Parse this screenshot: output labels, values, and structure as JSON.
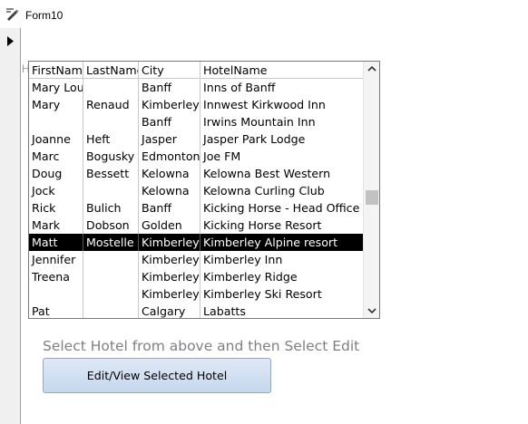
{
  "window": {
    "title": "Form10"
  },
  "listbox": {
    "label_stub": "H",
    "columns": [
      "FirstNam",
      "LastName",
      "City",
      "HotelName"
    ],
    "rows": [
      [
        "Mary Lou",
        "",
        "Banff",
        "Inns of Banff"
      ],
      [
        "Mary",
        "Renaud",
        "Kimberley",
        "Innwest Kirkwood Inn"
      ],
      [
        "",
        "",
        "Banff",
        "Irwins Mountain Inn"
      ],
      [
        "Joanne",
        "Heft",
        "Jasper",
        "Jasper Park Lodge"
      ],
      [
        "Marc",
        "Bogusky",
        "Edmonton",
        "Joe FM"
      ],
      [
        "Doug",
        "Bessett",
        "Kelowna",
        "Kelowna Best Western"
      ],
      [
        "Jock",
        "",
        "Kelowna",
        "Kelowna Curling Club"
      ],
      [
        "Rick",
        "Bulich",
        "Banff",
        "Kicking Horse - Head Office"
      ],
      [
        "Mark",
        "Dobson",
        "Golden",
        "Kicking Horse Resort"
      ],
      [
        "Matt",
        "Mostelle",
        "Kimberley",
        "Kimberley Alpine resort"
      ],
      [
        "Jennifer",
        "",
        "Kimberley",
        "Kimberley Inn"
      ],
      [
        "Treena",
        "",
        "Kimberley",
        "Kimberley Ridge"
      ],
      [
        "",
        "",
        "Kimberley",
        "Kimberley Ski Resort"
      ],
      [
        "Pat",
        "",
        "Calgary",
        "Labatts"
      ]
    ],
    "selected_row": 9
  },
  "instruction_text": "Select Hotel from above and then Select Edit",
  "edit_button_label": "Edit/View Selected Hotel",
  "colors": {
    "selection_bg": "#000000",
    "selection_fg": "#ffffff",
    "instruction": "#7f7f7f",
    "button_bg": "#c5d7ee"
  },
  "icons": {
    "title": "form-pencil-icon",
    "record_selector": "record-pointer-arrow-icon",
    "scroll_up": "chevron-up-icon",
    "scroll_down": "chevron-down-icon"
  }
}
